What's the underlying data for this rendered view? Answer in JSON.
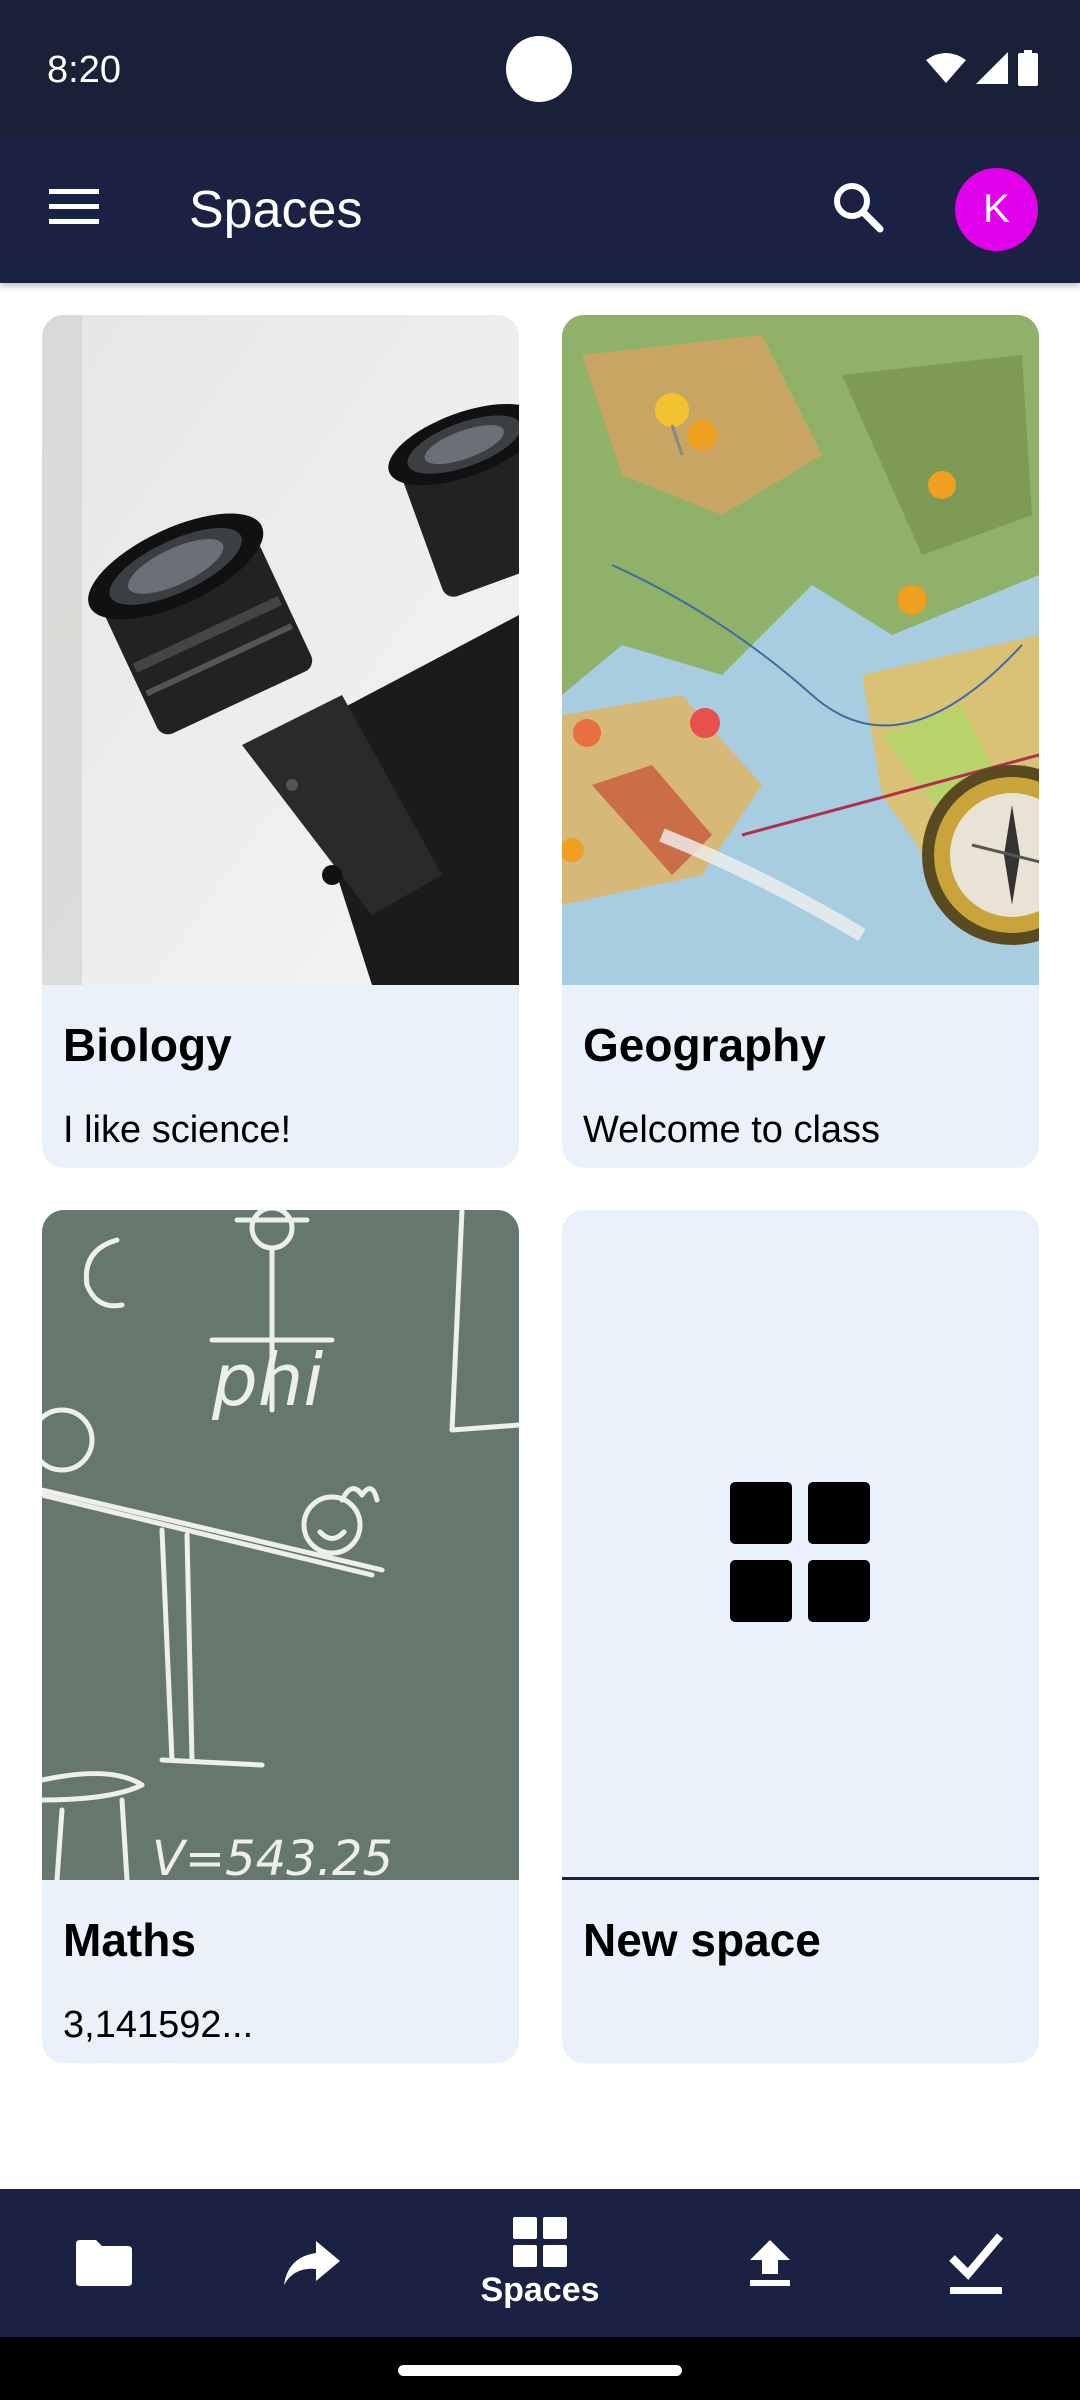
{
  "status_bar": {
    "time": "8:20"
  },
  "app_bar": {
    "title": "Spaces",
    "avatar_initial": "K",
    "avatar_color": "#e100ea"
  },
  "spaces": [
    {
      "title": "Biology",
      "subtitle": "I like science!",
      "image": "microscope"
    },
    {
      "title": "Geography",
      "subtitle": "Welcome to class",
      "image": "map-with-pins-and-compass"
    },
    {
      "title": "Maths",
      "subtitle": "3,141592...",
      "image": "chalkboard",
      "chalk_text_1": "phi",
      "chalk_text_2": "V=543.25"
    },
    {
      "title": "New space",
      "subtitle": "",
      "image": "grid-icon"
    }
  ],
  "bottom_nav": {
    "items": [
      {
        "icon": "folder-icon",
        "label": ""
      },
      {
        "icon": "share-icon",
        "label": ""
      },
      {
        "icon": "grid-icon",
        "label": "Spaces",
        "active": true
      },
      {
        "icon": "upload-icon",
        "label": ""
      },
      {
        "icon": "check-icon",
        "label": ""
      }
    ]
  },
  "colors": {
    "bar": "#1b2142",
    "card_background": "#eaf1fb"
  }
}
